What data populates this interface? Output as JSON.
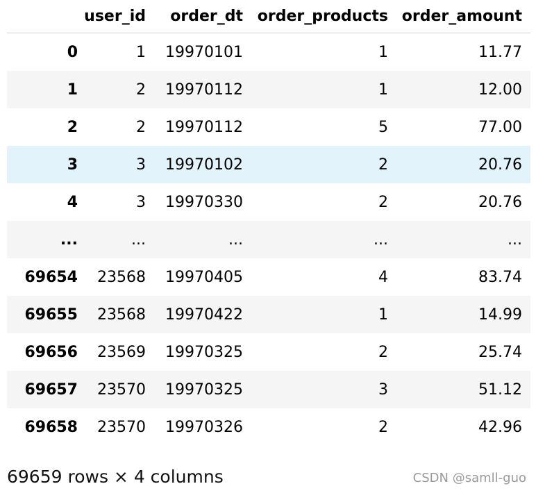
{
  "table": {
    "columns": [
      "",
      "user_id",
      "order_dt",
      "order_products",
      "order_amount"
    ],
    "rows": [
      {
        "index": "0",
        "cells": [
          "1",
          "19970101",
          "1",
          "11.77"
        ],
        "style": "even"
      },
      {
        "index": "1",
        "cells": [
          "2",
          "19970112",
          "1",
          "12.00"
        ],
        "style": "odd"
      },
      {
        "index": "2",
        "cells": [
          "2",
          "19970112",
          "5",
          "77.00"
        ],
        "style": "even"
      },
      {
        "index": "3",
        "cells": [
          "3",
          "19970102",
          "2",
          "20.76"
        ],
        "style": "hover"
      },
      {
        "index": "4",
        "cells": [
          "3",
          "19970330",
          "2",
          "20.76"
        ],
        "style": "even"
      },
      {
        "index": "...",
        "cells": [
          "...",
          "...",
          "...",
          "..."
        ],
        "style": "odd"
      },
      {
        "index": "69654",
        "cells": [
          "23568",
          "19970405",
          "4",
          "83.74"
        ],
        "style": "even"
      },
      {
        "index": "69655",
        "cells": [
          "23568",
          "19970422",
          "1",
          "14.99"
        ],
        "style": "odd"
      },
      {
        "index": "69656",
        "cells": [
          "23569",
          "19970325",
          "2",
          "25.74"
        ],
        "style": "even"
      },
      {
        "index": "69657",
        "cells": [
          "23570",
          "19970325",
          "3",
          "51.12"
        ],
        "style": "odd"
      },
      {
        "index": "69658",
        "cells": [
          "23570",
          "19970326",
          "2",
          "42.96"
        ],
        "style": "even"
      }
    ]
  },
  "footer": {
    "summary": "69659 rows × 4 columns"
  },
  "watermark": {
    "text": "CSDN @samll-guo"
  },
  "colors": {
    "hover_row": "#e2f3fb",
    "striped_row": "#f5f5f5",
    "header_border": "#cfcfcf",
    "watermark": "#9a9a9a"
  }
}
